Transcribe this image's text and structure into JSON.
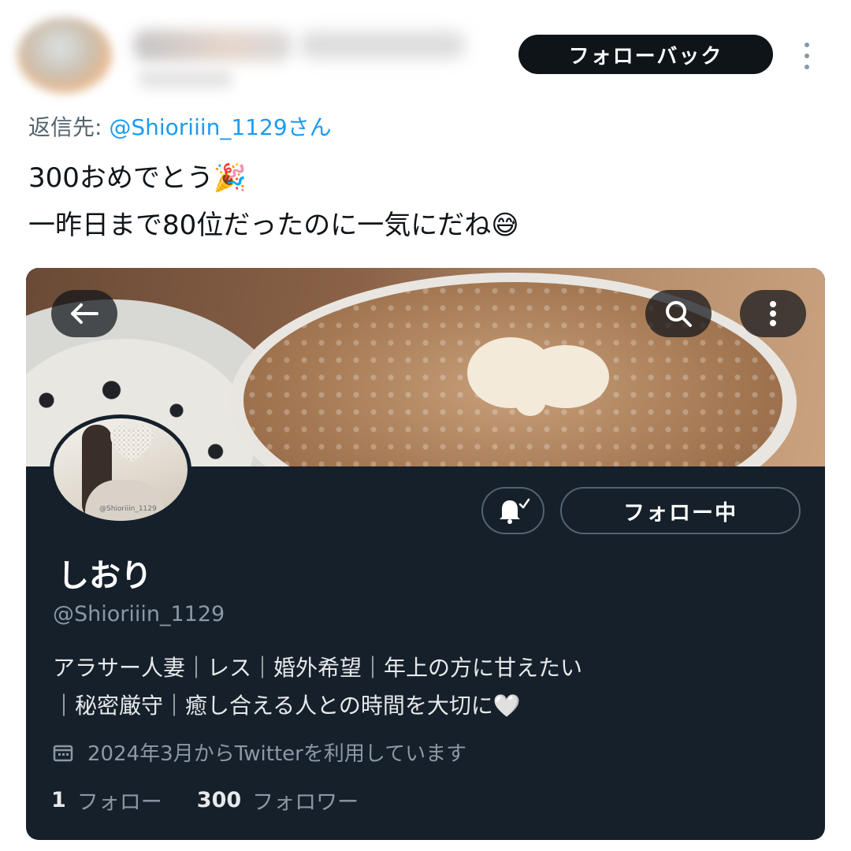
{
  "tweet": {
    "follow_back_label": "フォローバック",
    "reply_prefix": "返信先: ",
    "reply_handle": "@Shioriiin_1129",
    "reply_suffix": "さん",
    "line1": "300おめでとう",
    "line1_emoji": "🎉",
    "line2": "一昨日まで80位だったのに一気にだね",
    "line2_emoji": "😅"
  },
  "profile_card": {
    "name": "しおり",
    "handle": "@Shioriiin_1129",
    "avatar_caption": "@Shioriiin_1129",
    "following_label": "フォロー中",
    "bio_line1": "アラサー人妻｜レス｜婚外希望｜年上の方に甘えたい",
    "bio_line2": "｜秘密厳守｜癒し合える人との時間を大切に",
    "bio_emoji": "🤍",
    "joined": "2024年3月からTwitterを利用しています",
    "following_count": "1",
    "following_text": "フォロー",
    "followers_count": "300",
    "followers_text": "フォロワー"
  },
  "icons": [
    "back-arrow-icon",
    "search-icon",
    "more-icon",
    "notification-bell-icon",
    "calendar-icon"
  ],
  "colors": {
    "accent_blue": "#1d9bf0",
    "card_bg": "#15202b",
    "dark_button": "#0f1419",
    "muted_text": "#8b98a5"
  }
}
